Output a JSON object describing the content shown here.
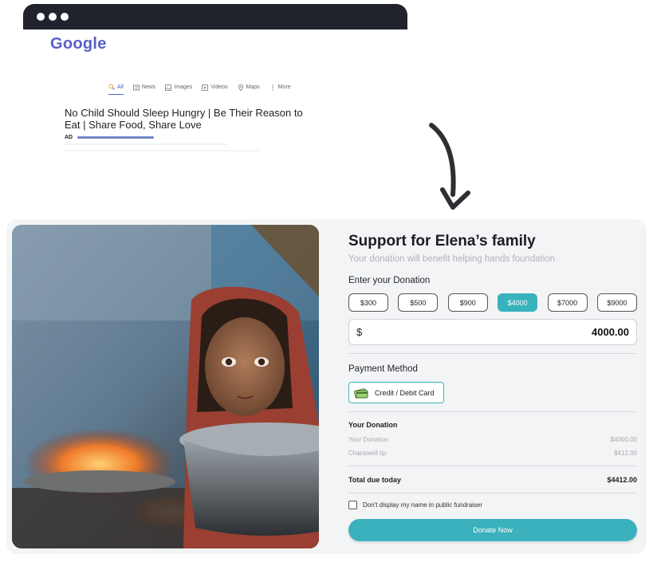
{
  "browser": {
    "logo": "Google",
    "tabs": [
      {
        "label": "All",
        "icon": "search-icon",
        "active": true
      },
      {
        "label": "News",
        "icon": "news-icon",
        "active": false
      },
      {
        "label": "Images",
        "icon": "image-icon",
        "active": false
      },
      {
        "label": "Videos",
        "icon": "video-icon",
        "active": false
      },
      {
        "label": "Maps",
        "icon": "map-pin-icon",
        "active": false
      },
      {
        "label": "More",
        "icon": "more-icon",
        "active": false
      }
    ],
    "ad_title": "No Child Should Sleep Hungry | Be Their Reason to Eat | Share Food, Share Love",
    "ad_label": "AD"
  },
  "donation": {
    "title": "Support for Elena’s family",
    "subtitle": "Your donation will benefit helping hands foundation",
    "enter_label": "Enter your Donation",
    "amounts": [
      "$300",
      "$500",
      "$900",
      "$4000",
      "$7000",
      "$9000"
    ],
    "selected_amount": "$4000",
    "currency_symbol": "$",
    "input_value": "4000.00",
    "payment_label": "Payment Method",
    "payment_option": "Credit / Debit Card",
    "summary_title": "Your Donation",
    "rows": [
      {
        "label": "Your Donation",
        "value": "$4000.00"
      },
      {
        "label": "Chariswell tip",
        "value": "$412.00"
      }
    ],
    "total_label": "Total due today",
    "total_value": "$4412.00",
    "anonymous_label": "Don't display my name in public fundraiser",
    "donate_label": "Donate Now",
    "accent_color": "#38b2bd"
  }
}
